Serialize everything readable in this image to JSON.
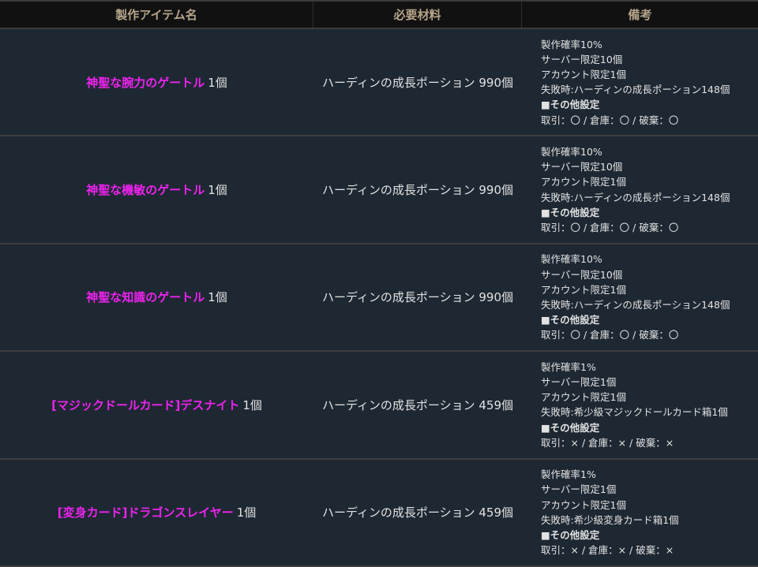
{
  "header": {
    "col1": "製作アイテム名",
    "col2": "必要材料",
    "col3": "備考"
  },
  "rows": [
    {
      "name": "神聖な腕力のゲートル",
      "qty": "1個",
      "material": "ハーディンの成長ポーション 990個",
      "notes": [
        "製作確率10%",
        "サーバー限定10個",
        "アカウント限定1個",
        "失敗時:ハーディンの成長ポーション148個",
        "■その他設定",
        "取引：〇 / 倉庫：〇 / 破棄：〇"
      ]
    },
    {
      "name": "神聖な機敏のゲートル",
      "qty": "1個",
      "material": "ハーディンの成長ポーション 990個",
      "notes": [
        "製作確率10%",
        "サーバー限定10個",
        "アカウント限定1個",
        "失敗時:ハーディンの成長ポーション148個",
        "■その他設定",
        "取引：〇 / 倉庫：〇 / 破棄：〇"
      ]
    },
    {
      "name": "神聖な知識のゲートル",
      "qty": "1個",
      "material": "ハーディンの成長ポーション 990個",
      "notes": [
        "製作確率10%",
        "サーバー限定10個",
        "アカウント限定1個",
        "失敗時:ハーディンの成長ポーション148個",
        "■その他設定",
        "取引：〇 / 倉庫：〇 / 破棄：〇"
      ]
    },
    {
      "name": "[マジックドールカード]デスナイト",
      "qty": "1個",
      "material": "ハーディンの成長ポーション 459個",
      "notes": [
        "製作確率1%",
        "サーバー限定1個",
        "アカウント限定1個",
        "失敗時:希少級マジックドールカード箱1個",
        "■その他設定",
        "取引：× / 倉庫：× / 破棄：×"
      ]
    },
    {
      "name": "[変身カード]ドラゴンスレイヤー",
      "qty": "1個",
      "material": "ハーディンの成長ポーション 459個",
      "notes": [
        "製作確率1%",
        "サーバー限定1個",
        "アカウント限定1個",
        "失敗時:希少級変身カード箱1個",
        "■その他設定",
        "取引：× / 倉庫：× / 破棄：×"
      ]
    }
  ]
}
